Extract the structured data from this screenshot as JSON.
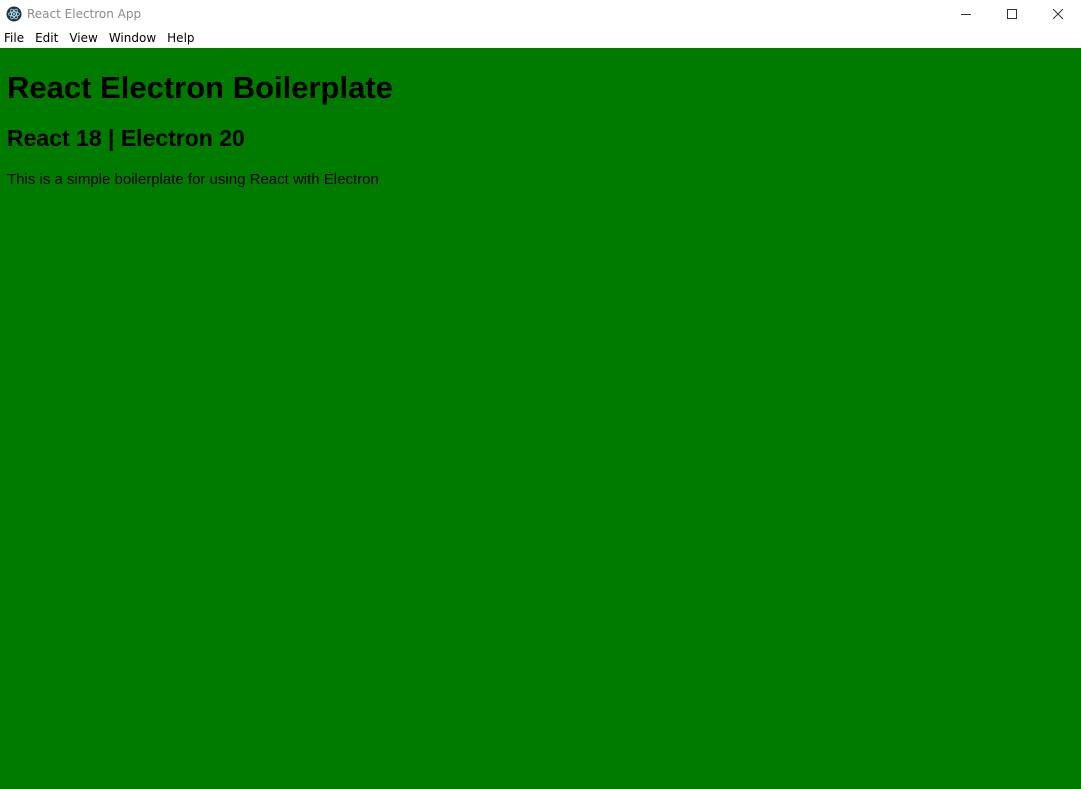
{
  "window": {
    "title": "React Electron App",
    "app_icon": "electron-logo-icon",
    "controls": {
      "minimize_icon": "minimize-icon",
      "maximize_icon": "maximize-icon",
      "close_icon": "close-icon"
    }
  },
  "menubar": {
    "items": [
      {
        "label": "File"
      },
      {
        "label": "Edit"
      },
      {
        "label": "View"
      },
      {
        "label": "Window"
      },
      {
        "label": "Help"
      }
    ]
  },
  "content": {
    "heading": "React Electron Boilerplate",
    "subheading": "React 18 | Electron 20",
    "description": "This is a simple boilerplate for using React with Electron",
    "background_color": "#007b00"
  }
}
